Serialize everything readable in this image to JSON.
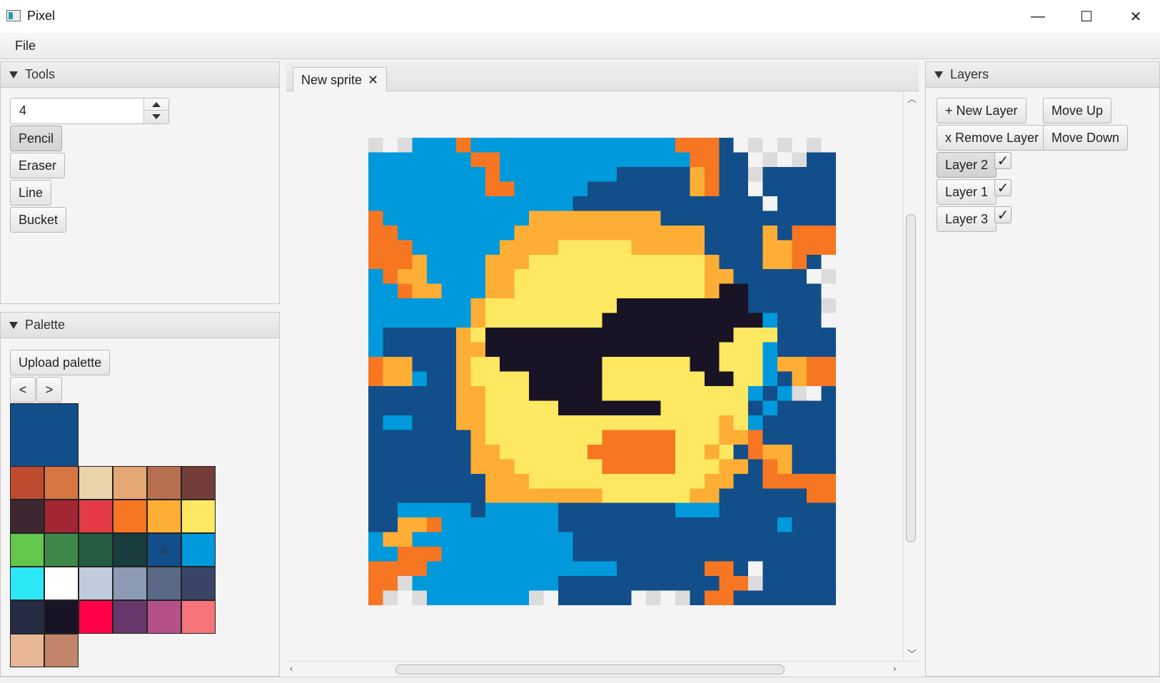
{
  "window": {
    "title": "Pixel",
    "minimize": "—",
    "maximize": "☐",
    "close": "✕"
  },
  "menu": {
    "file": "File"
  },
  "tools": {
    "header": "Tools",
    "size_value": "4",
    "buttons": [
      "Pencil",
      "Eraser",
      "Line",
      "Bucket"
    ]
  },
  "palette": {
    "header": "Palette",
    "upload": "Upload palette",
    "prev": "<",
    "next": ">",
    "current_color": "#124e89",
    "selected_marker": "S",
    "swatches": [
      "#be4a2f",
      "#d77643",
      "#ead4aa",
      "#e4a672",
      "#b86f50",
      "#733e39",
      "#3e2731",
      "#a22633",
      "#e43b44",
      "#f77622",
      "#feae34",
      "#fee761",
      "#63c74d",
      "#3e8948",
      "#265c42",
      "#193c3e",
      "#124e89",
      "#0099db",
      "#2ce8f5",
      "#ffffff",
      "#c0cbdc",
      "#8b9bb4",
      "#5a6988",
      "#3a4466",
      "#262b44",
      "#181425",
      "#ff0044",
      "#68386c",
      "#b55088",
      "#f6757a",
      "#e8b796",
      "#c28569"
    ]
  },
  "editor": {
    "tab_label": "New sprite",
    "tab_close": "✕"
  },
  "layers": {
    "header": "Layers",
    "new_layer": "+ New Layer",
    "remove_layer": "x Remove Layer",
    "move_up": "Move Up",
    "move_down": "Move Down",
    "items": [
      {
        "label": "Layer 2",
        "visible": true,
        "selected": true
      },
      {
        "label": "Layer 1",
        "visible": true,
        "selected": false
      },
      {
        "label": "Layer 3",
        "visible": true,
        "selected": false
      }
    ],
    "check_glyph": "✓"
  },
  "sprite": {
    "size": 32,
    "legend": {
      "C": "#0099db",
      "N": "#124e89",
      "O": "#f77622",
      "A": "#feae34",
      "Y": "#fee761",
      "K": "#181425",
      "T": "transparent"
    },
    "rows": [
      "TTTCCCOCCCCCCCCCCCCCCOOONTTTTTTT",
      "CCCCCCCOOCCCCCCCCCCCCCOONNTTTTNN",
      "CCCCCCCCOCCCCCCCCNNNNNAONNTNNNNN",
      "CCCCCCCCOOCCCCCNNNNNNNAONNTNNNNN",
      "CCCCCCCCCCCCCCNNNNNNNNNNNNNTNNNN",
      "OCCCCCCCCCCAAAAAAAAANNNNNNNNNNNN",
      "OOCCCCCCCCAAAAAAAAAAAAANNNNANOOO",
      "OOOCCCCCCAAAAYYYYYAAAAANNNNAAOOO",
      "OOOACCCCAAAYYYYYYYYYYYYANNNAAONT",
      "COAACCCCAAYYYYYYYYYYYYYAANNNNNTT",
      "CCOAACCCAAYYYYYYYYYYYYYAKKNNNNNT",
      "CCCCCCCAYYYYYYYYYKKKKKKKKKNNNNNT",
      "CCCCCCCAYYYYYYYYKKKKKKKKKKKCNNNT",
      "CNNNNNAYKKKKKKKKKKKKKKKKKYYYNNNN",
      "CNNNNNAAKKKKKKKKKKKKKKKKYYYCNNNN",
      "OAANNNAYYKKKKKKKYYYYYYKKYYYCAAOO",
      "OAACNNAYYYYKKKKKYYYYYYYKKYYCNAOO",
      "NNNNNNAAYYYKKKKKYYYYYYYYYYCNCTTN",
      "NNNNNNAAYYYYYKKKKKKKYYYYYYNCNNNN",
      "NCCNNNAAYYYYYYYYYYYYYYYYAYCNNNNN",
      "NNNNNNNAYYYYYYYYOOOOOYYYAAONNNNN",
      "NNNNNNNAAYYYYYYOOOOOOYYAYNOAANNN",
      "NNNNNNNAAAYYYYYYOOOOOYYYAANOANNN",
      "NNNNNNNNAAAYYYYYYYYYYYYAANNOOOOO",
      "NNNNNNNNAAAAAAAAYYYYYYAANNNNNNOO",
      "NNCCCCCNCCCCCNNNNNNNNCCCNNNNNNNN",
      "NNAAOCCCCCCCCNNNNNNNNNNNNNNNCNNN",
      "CAACCCCCCCCCCCNNNNNNNNNNNNNNNNNN",
      "CCOOOCCCCCCCCCNNNNNNNNNNNNNNNNNN",
      "OOOOCCCCCCCCCCCCCNNNNNNOONTNNNNN",
      "OOTCCCCCCCCCCNNNNNNNNNNNOOTNNNNN",
      "OTTTCCCCCCCTTNNNNNTTTTNOONNNNNNN"
    ]
  }
}
